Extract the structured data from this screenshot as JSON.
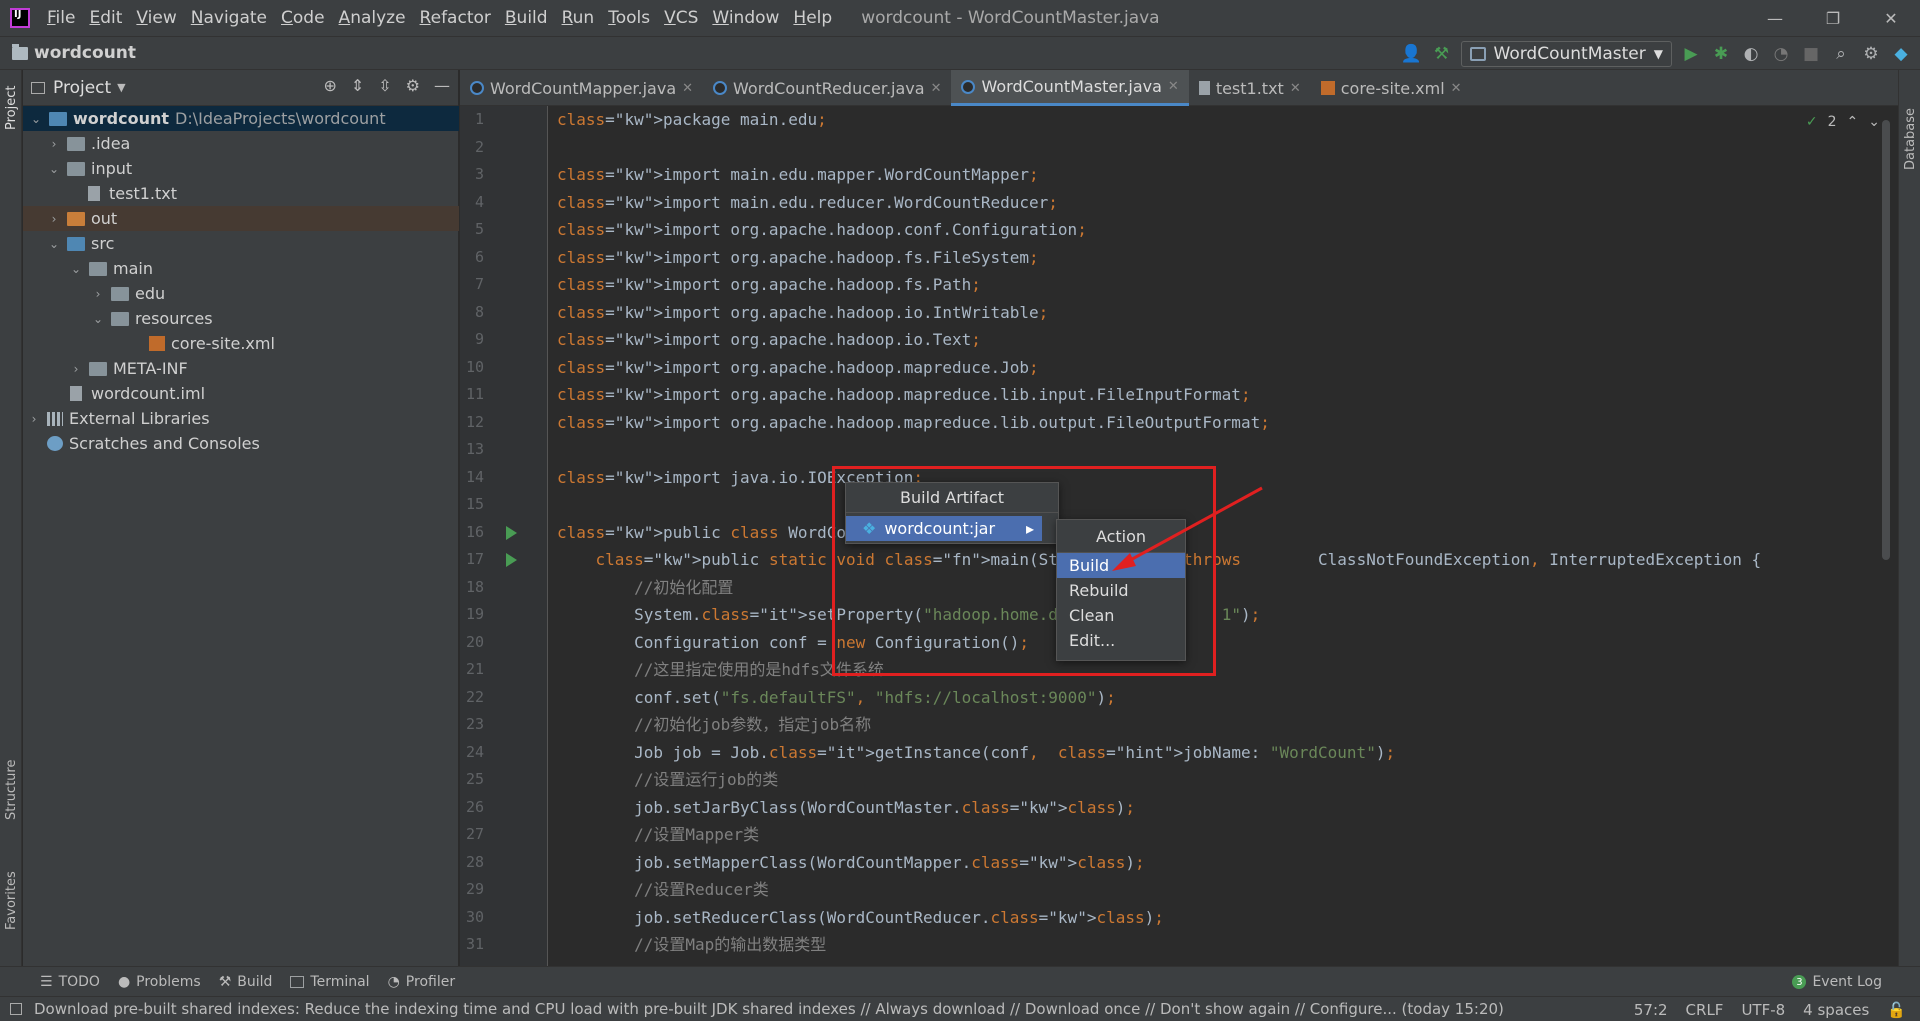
{
  "menubar": {
    "items": [
      "File",
      "Edit",
      "View",
      "Navigate",
      "Code",
      "Analyze",
      "Refactor",
      "Build",
      "Run",
      "Tools",
      "VCS",
      "Window",
      "Help"
    ],
    "window_title": "wordcount - WordCountMaster.java",
    "controls": {
      "minimize": "—",
      "restore": "❐",
      "close": "✕"
    }
  },
  "navbar": {
    "project_name": "wordcount",
    "run_config": "WordCountMaster"
  },
  "sidebar_strip": {
    "project": "Project",
    "structure": "Structure",
    "favorites": "Favorites",
    "database": "Database"
  },
  "project_panel": {
    "title": "Project",
    "tree": [
      {
        "label": "wordcount",
        "path": "D:\\IdeaProjects\\wordcount",
        "bold": true,
        "expanded": true,
        "icon": "folder-module",
        "depth": 0
      },
      {
        "label": ".idea",
        "icon": "folder",
        "expanded": false,
        "depth": 1
      },
      {
        "label": "input",
        "icon": "folder",
        "expanded": true,
        "depth": 1
      },
      {
        "label": "test1.txt",
        "icon": "text-file",
        "depth": 2
      },
      {
        "label": "out",
        "icon": "folder-excluded",
        "expanded": false,
        "depth": 1
      },
      {
        "label": "src",
        "icon": "folder-source",
        "expanded": true,
        "depth": 1
      },
      {
        "label": "main",
        "icon": "folder",
        "expanded": true,
        "depth": 2
      },
      {
        "label": "edu",
        "icon": "folder",
        "expanded": false,
        "depth": 3
      },
      {
        "label": "resources",
        "icon": "folder",
        "expanded": true,
        "depth": 3
      },
      {
        "label": "core-site.xml",
        "icon": "xml-file",
        "depth": 4
      },
      {
        "label": "META-INF",
        "icon": "folder",
        "expanded": false,
        "depth": 2
      },
      {
        "label": "wordcount.iml",
        "icon": "iml-file",
        "depth": 1
      },
      {
        "label": "External Libraries",
        "icon": "library",
        "expanded": false,
        "depth": 0
      },
      {
        "label": "Scratches and Consoles",
        "icon": "scratch",
        "depth": 0
      }
    ]
  },
  "tabs": [
    {
      "label": "WordCountMapper.java",
      "icon": "java-class",
      "active": false
    },
    {
      "label": "WordCountReducer.java",
      "icon": "java-class",
      "active": false
    },
    {
      "label": "WordCountMaster.java",
      "icon": "java-class",
      "active": true
    },
    {
      "label": "test1.txt",
      "icon": "text-file",
      "active": false
    },
    {
      "label": "core-site.xml",
      "icon": "xml-file",
      "active": false
    }
  ],
  "inspection": {
    "count": "2"
  },
  "code": [
    "package main.edu;",
    "",
    "import main.edu.mapper.WordCountMapper;",
    "import main.edu.reducer.WordCountReducer;",
    "import org.apache.hadoop.conf.Configuration;",
    "import org.apache.hadoop.fs.FileSystem;",
    "import org.apache.hadoop.fs.Path;",
    "import org.apache.hadoop.io.IntWritable;",
    "import org.apache.hadoop.io.Text;",
    "import org.apache.hadoop.mapreduce.Job;",
    "import org.apache.hadoop.mapreduce.lib.input.FileInputFormat;",
    "import org.apache.hadoop.mapreduce.lib.output.FileOutputFormat;",
    "",
    "import java.io.IOException;",
    "",
    "public class WordCountMaster",
    "    public static void main(String[] args) throws        ClassNotFoundException, InterruptedException {",
    "        //初始化配置",
    "        System.setProperty(\"hadoop.home.dir\", \"D:\\        1\");",
    "        Configuration conf = new Configuration();",
    "        //这里指定使用的是hdfs文件系统",
    "        conf.set(\"fs.defaultFS\", \"hdfs://localhost:9000\");",
    "        //初始化job参数，指定job名称",
    "        Job job = Job.getInstance(conf,  jobName: \"WordCount\");",
    "        //设置运行job的类",
    "        job.setJarByClass(WordCountMaster.class);",
    "        //设置Mapper类",
    "        job.setMapperClass(WordCountMapper.class);",
    "        //设置Reducer类",
    "        job.setReducerClass(WordCountReducer.class);",
    "        //设置Map的输出数据类型"
  ],
  "popup_artifact": {
    "title": "Build Artifact",
    "item": "wordcount:jar"
  },
  "popup_action": {
    "title": "Action",
    "items": [
      "Build",
      "Rebuild",
      "Clean",
      "Edit..."
    ],
    "selected": "Build"
  },
  "bottom_toolbar": {
    "items": [
      "TODO",
      "Problems",
      "Build",
      "Terminal",
      "Profiler"
    ],
    "event_log": "Event Log",
    "event_count": "3"
  },
  "status_bar": {
    "message": "Download pre-built shared indexes: Reduce the indexing time and CPU load with pre-built JDK shared indexes // Always download // Download once // Don't show again // Configure... (today 15:20)",
    "position": "57:2",
    "line_sep": "CRLF",
    "encoding": "UTF-8",
    "indent": "4 spaces"
  },
  "colors": {
    "annotation": "#e02020",
    "selection": "#4b6eaf",
    "keyword": "#cc7832",
    "string": "#6a8759",
    "comment": "#808080"
  }
}
